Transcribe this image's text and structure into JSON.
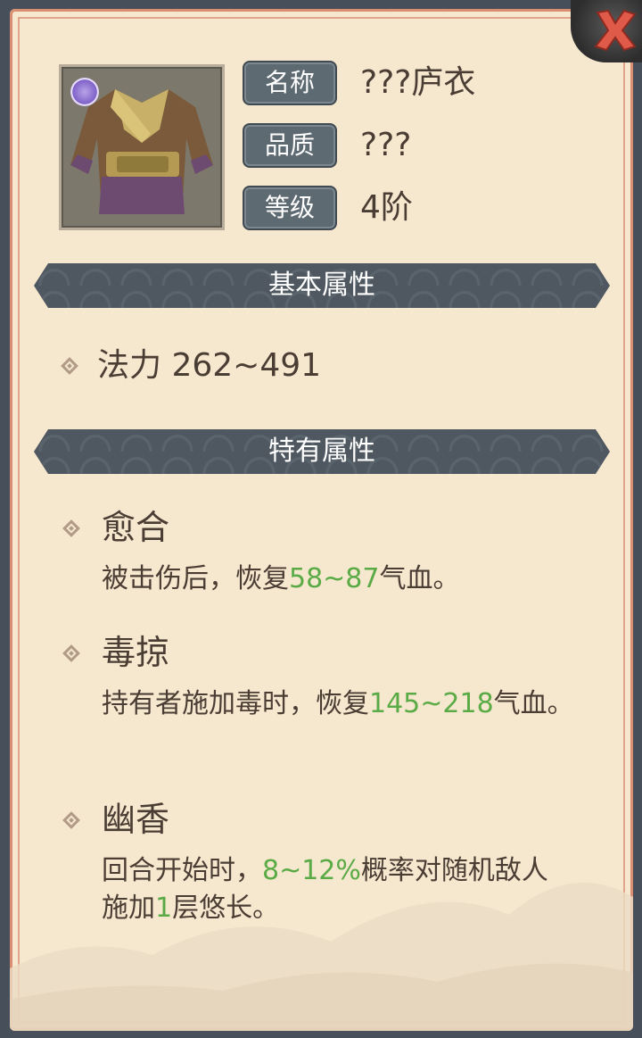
{
  "item": {
    "icon": "robe-icon",
    "quality_icon": "purple-swirl-icon",
    "name_label": "名称",
    "name_value": "???庐衣",
    "quality_label": "品质",
    "quality_value": "???",
    "level_label": "等级",
    "level_value": "4阶"
  },
  "sections": {
    "basic_title": "基本属性",
    "special_title": "特有属性"
  },
  "basic_attr": "法力 262~491",
  "skills": [
    {
      "name": "愈合",
      "desc_pre": "被击伤后，恢复",
      "desc_hl": "58~87",
      "desc_post": "气血。"
    },
    {
      "name": "毒掠",
      "desc_pre": "持有者施加毒时，恢复",
      "desc_hl": "145~218",
      "desc_post": "气血。"
    },
    {
      "name": "幽香",
      "desc_pre": "回合开始时，",
      "desc_hl": "8~12%",
      "desc_mid": "概率对随机敌人施加",
      "desc_hl2": "1",
      "desc_post": "层悠长。"
    }
  ],
  "colors": {
    "panel_bg": "#f6e7cf",
    "border": "#d98d72",
    "highlight_green": "#5aab46",
    "text_brown": "#4a3d33",
    "tag_bg": "#5e6a72",
    "close_red": "#e05a4a"
  }
}
